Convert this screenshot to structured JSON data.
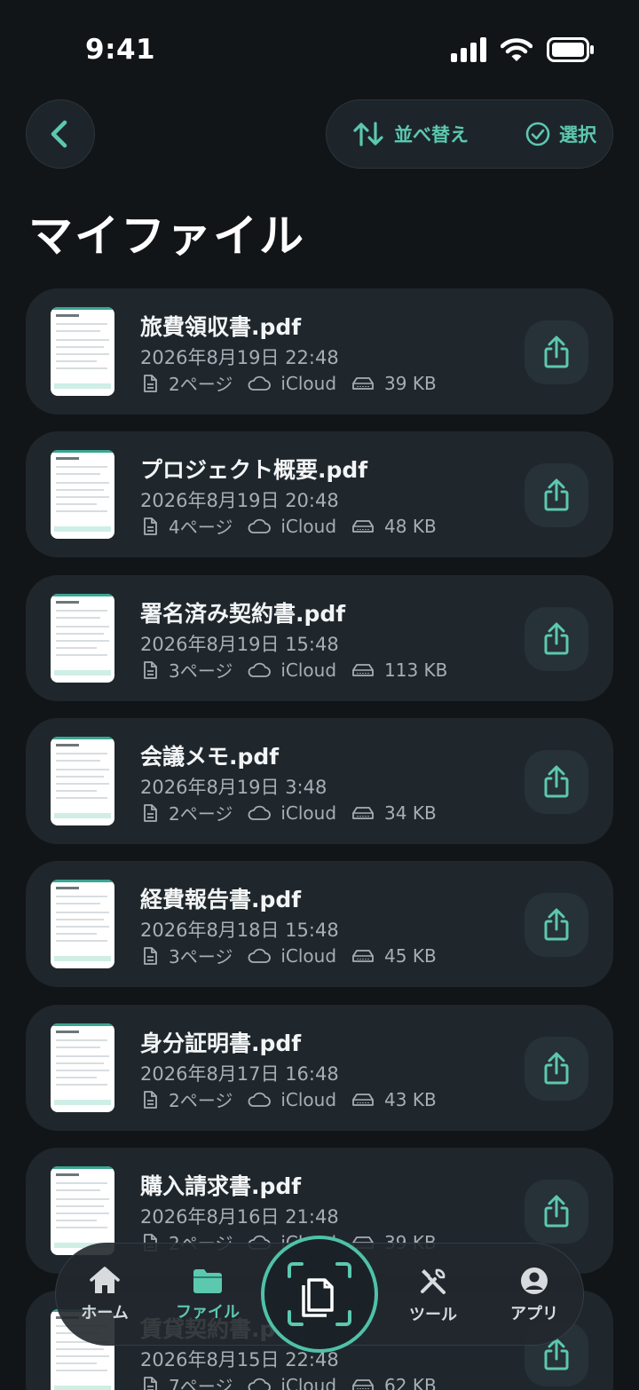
{
  "status": {
    "time": "9:41"
  },
  "toolbar": {
    "sort_label": "並べ替え",
    "select_label": "選択"
  },
  "page_title": "マイファイル",
  "files": [
    {
      "name": "旅費領収書.pdf",
      "date": "2026年8月19日 22:48",
      "pages": "2ページ",
      "storage": "iCloud",
      "size": "39 KB"
    },
    {
      "name": "プロジェクト概要.pdf",
      "date": "2026年8月19日 20:48",
      "pages": "4ページ",
      "storage": "iCloud",
      "size": "48 KB"
    },
    {
      "name": "署名済み契約書.pdf",
      "date": "2026年8月19日 15:48",
      "pages": "3ページ",
      "storage": "iCloud",
      "size": "113 KB"
    },
    {
      "name": "会議メモ.pdf",
      "date": "2026年8月19日 3:48",
      "pages": "2ページ",
      "storage": "iCloud",
      "size": "34 KB"
    },
    {
      "name": "経費報告書.pdf",
      "date": "2026年8月18日 15:48",
      "pages": "3ページ",
      "storage": "iCloud",
      "size": "45 KB"
    },
    {
      "name": "身分証明書.pdf",
      "date": "2026年8月17日 16:48",
      "pages": "2ページ",
      "storage": "iCloud",
      "size": "43 KB"
    },
    {
      "name": "購入請求書.pdf",
      "date": "2026年8月16日 21:48",
      "pages": "2ページ",
      "storage": "iCloud",
      "size": "39 KB"
    },
    {
      "name": "賃貸契約書.pdf",
      "date": "2026年8月15日 22:48",
      "pages": "7ページ",
      "storage": "iCloud",
      "size": "62 KB"
    }
  ],
  "tabs": [
    {
      "label": "ホーム",
      "icon": "home-icon"
    },
    {
      "label": "ファイル",
      "icon": "folder-icon",
      "active": true
    },
    {
      "label": "ツール",
      "icon": "tools-icon"
    },
    {
      "label": "アプリ",
      "icon": "account-icon"
    }
  ],
  "colors": {
    "accent": "#5cc8b0",
    "background": "#121518",
    "card": "#1f272d"
  }
}
